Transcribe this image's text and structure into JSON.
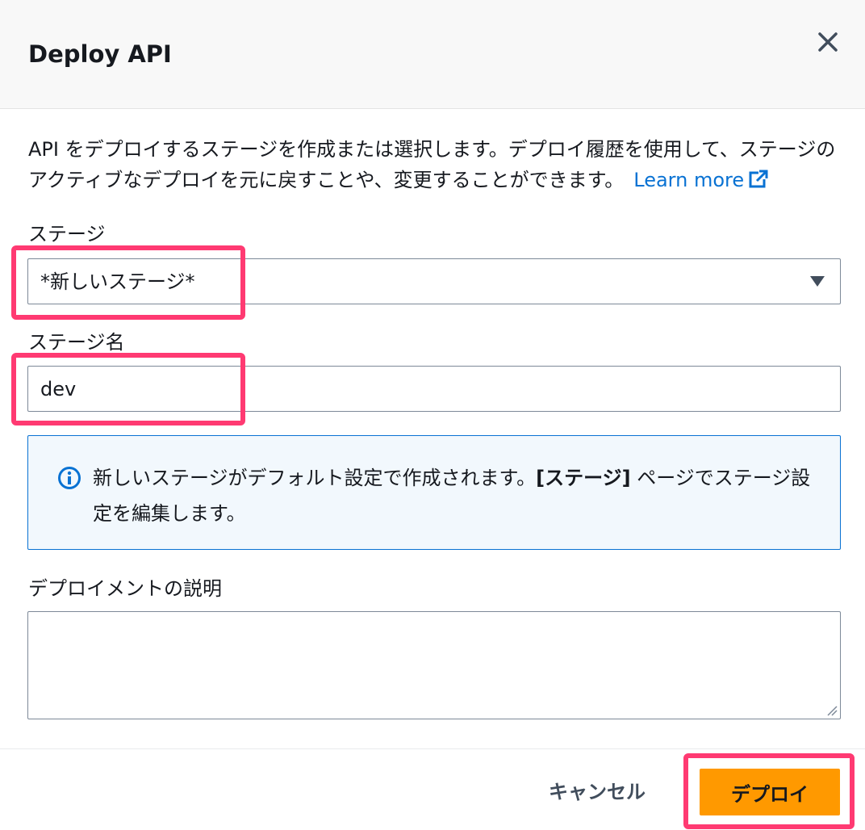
{
  "header": {
    "title": "Deploy API",
    "close_icon": "close-icon"
  },
  "description": {
    "text": "API をデプロイするステージを作成または選択します。デプロイ履歴を使用して、ステージのアクティブなデプロイを元に戻すことや、変更することができます。",
    "learn_more": "Learn more",
    "learn_more_icon": "external-link-icon"
  },
  "stage_select": {
    "label": "ステージ",
    "value": "*新しいステージ*"
  },
  "stage_name": {
    "label": "ステージ名",
    "value": "dev"
  },
  "info": {
    "text_before": "新しいステージがデフォルト設定で作成されます。",
    "bold": "[ステージ]",
    "text_after": " ページでステージ設定を編集します。"
  },
  "deployment_description": {
    "label": "デプロイメントの説明",
    "value": ""
  },
  "footer": {
    "cancel_label": "キャンセル",
    "deploy_label": "デプロイ"
  },
  "colors": {
    "primary_button": "#ff9900",
    "link": "#0972d3",
    "info_background": "#f2f8fd",
    "highlight": "#ff3a72"
  }
}
